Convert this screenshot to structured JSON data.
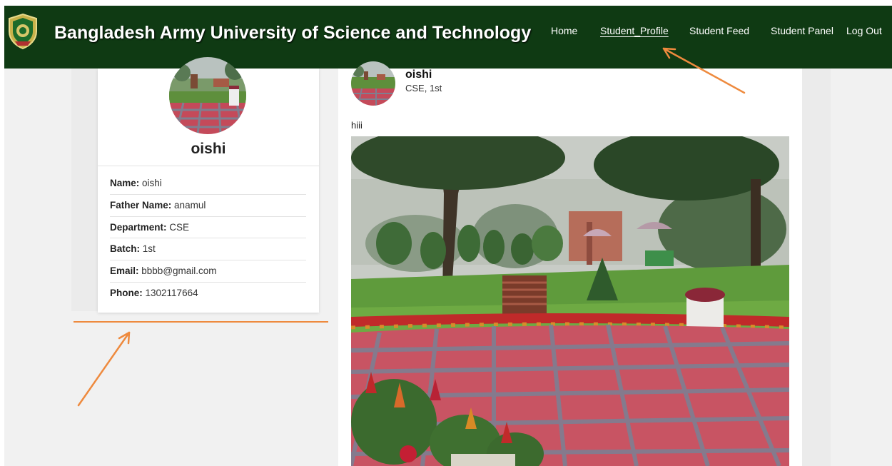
{
  "header": {
    "brand": "Bangladesh Army University of Science and Technology",
    "logo_icon": "university-crest-icon",
    "nav": [
      {
        "label": "Home",
        "active": false
      },
      {
        "label": "Student_Profile",
        "active": true
      },
      {
        "label": "Student Feed",
        "active": false
      },
      {
        "label": "Student Panel",
        "active": false
      },
      {
        "label": "Log Out",
        "active": false
      }
    ]
  },
  "profile": {
    "display_name": "oishi",
    "fields": [
      {
        "label": "Name:",
        "value": "oishi"
      },
      {
        "label": "Father Name:",
        "value": "anamul"
      },
      {
        "label": "Department:",
        "value": "CSE"
      },
      {
        "label": "Batch:",
        "value": "1st"
      },
      {
        "label": "Email:",
        "value": "bbbb@gmail.com"
      },
      {
        "label": "Phone:",
        "value": "1302117664"
      }
    ]
  },
  "post": {
    "user": "oishi",
    "meta": "CSE, 1st",
    "text": "hiii"
  },
  "colors": {
    "navbar": "#0f3a13",
    "annotation": "#ee8a3e",
    "page_background": "#f1f1f1"
  }
}
